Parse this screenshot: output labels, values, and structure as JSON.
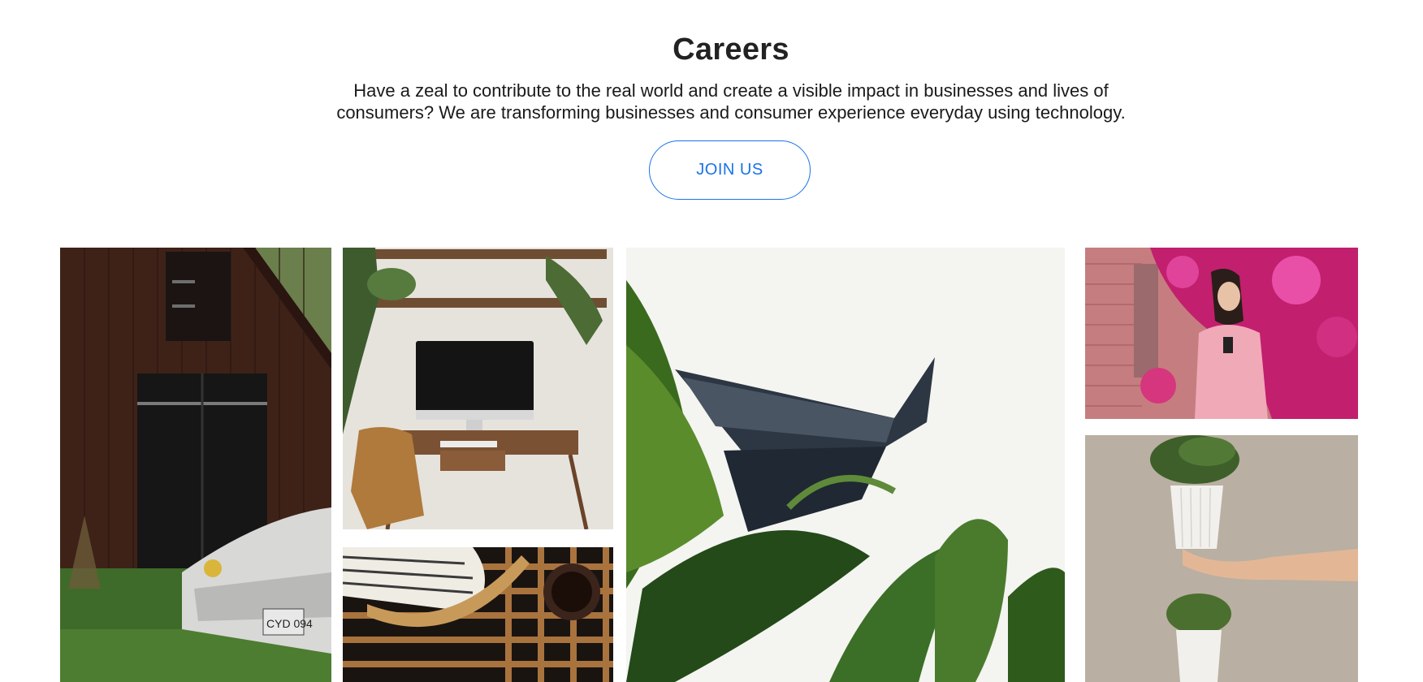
{
  "careers": {
    "title": "Careers",
    "description_line1": "Have a zeal to contribute to the real world and create a visible impact in businesses and lives of",
    "description_line2": "consumers? We are transforming businesses and consumer experience everyday using technology.",
    "cta_label": "JOIN US"
  },
  "colors": {
    "accent": "#1a73e8",
    "heading": "#222222",
    "background": "#ffffff"
  },
  "gallery": {
    "images": [
      {
        "subject": "red barn with vintage white car",
        "plate_text": "CYD 094"
      },
      {
        "subject": "home office desk with monitor and plants"
      },
      {
        "subject": "pagoda roof behind tropical leaves"
      },
      {
        "subject": "woman with phone in front of pink flowers"
      },
      {
        "subject": "hand holding potted succulent"
      },
      {
        "subject": "woven basket and coffee cup on slatted table"
      }
    ]
  }
}
